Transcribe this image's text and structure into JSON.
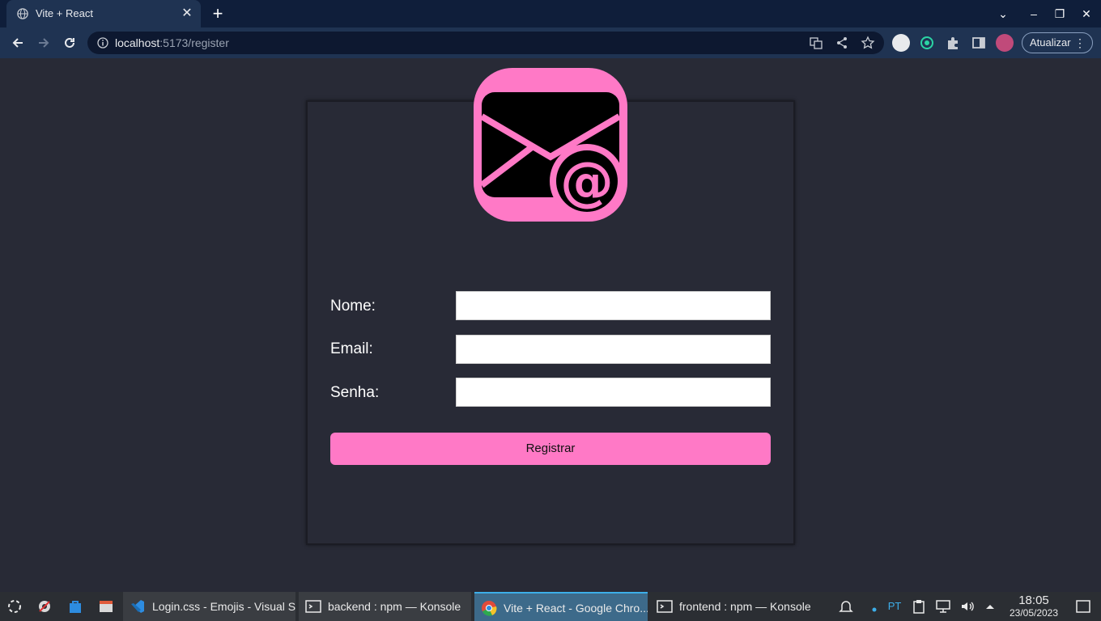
{
  "browser": {
    "tab_title": "Vite + React",
    "tab_close": "✕",
    "new_tab": "+",
    "url_host": "localhost",
    "url_rest": ":5173/register",
    "update_label": "Atualizar",
    "window_controls": {
      "list": "⌄",
      "minimize": "–",
      "restore": "❐",
      "close": "✕"
    }
  },
  "form": {
    "labels": {
      "name": "Nome:",
      "email": "Email:",
      "password": "Senha:"
    },
    "values": {
      "name": "",
      "email": "",
      "password": ""
    },
    "submit_label": "Registrar"
  },
  "colors": {
    "accent_pink": "#ff79c6",
    "page_bg": "#282a36",
    "browser_chrome": "#1f3352"
  },
  "taskbar": {
    "tasks": [
      {
        "label": "Login.css - Emojis - Visual S...",
        "icon": "vscode-icon"
      },
      {
        "label": "backend : npm — Konsole",
        "icon": "terminal-icon"
      },
      {
        "label": "Vite + React - Google Chro...",
        "icon": "chrome-icon"
      },
      {
        "label": "frontend : npm — Konsole",
        "icon": "terminal-icon"
      }
    ],
    "keyboard_layout": "PT",
    "time": "18:05",
    "date": "23/05/2023"
  }
}
